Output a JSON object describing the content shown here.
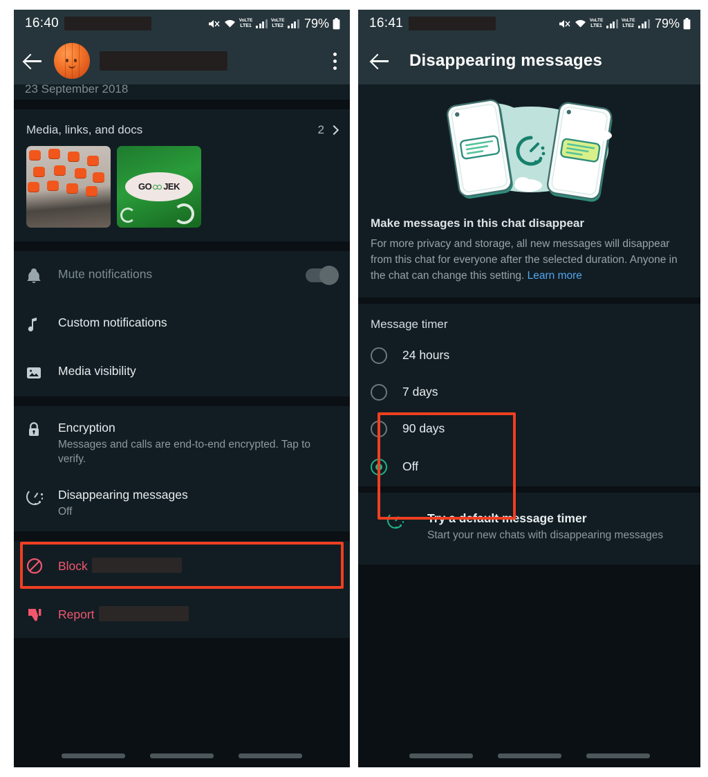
{
  "left_phone": {
    "status_bar": {
      "time": "16:40",
      "battery": "79%",
      "icons": [
        "mute-icon",
        "wifi-icon",
        "volte-lte1-icon",
        "signal-bars-icon",
        "volte-lte2-icon",
        "signal-bars-icon",
        "battery-icon"
      ],
      "volte_labels": [
        {
          "top": "VoLTE",
          "bottom": "LTE1"
        },
        {
          "top": "VoLTE",
          "bottom": "LTE2"
        }
      ]
    },
    "app_bar": {
      "back_icon": "back-arrow-icon",
      "avatar": "pumpkin-avatar",
      "contact_name": "",
      "overflow_icon": "kebab-menu-icon"
    },
    "scrolled_date": "23 September 2018",
    "media_section": {
      "label": "Media, links, and docs",
      "count": "2",
      "chevron": "chevron-right-icon",
      "thumbnails": [
        "orange-capped-bottles-photo",
        "gojek-green-bottle-photo"
      ],
      "thumb_b_text": [
        "GO",
        "JEK"
      ]
    },
    "settings_rows": [
      {
        "icon": "bell-icon",
        "title": "Mute notifications",
        "subtitle": "",
        "muted": true,
        "toggle": true,
        "toggle_on": false
      },
      {
        "icon": "music-note-icon",
        "title": "Custom notifications",
        "subtitle": "",
        "muted": false,
        "toggle": false
      },
      {
        "icon": "image-icon",
        "title": "Media visibility",
        "subtitle": "",
        "muted": false,
        "toggle": false
      }
    ],
    "privacy_rows": [
      {
        "icon": "lock-icon",
        "title": "Encryption",
        "subtitle": "Messages and calls are end-to-end encrypted. Tap to verify."
      },
      {
        "icon": "timer-icon",
        "title": "Disappearing messages",
        "subtitle": "Off",
        "highlighted": true
      }
    ],
    "danger_rows": [
      {
        "icon": "block-icon",
        "title": "Block",
        "redacted": true
      },
      {
        "icon": "thumbs-down-icon",
        "title": "Report",
        "redacted": true
      }
    ],
    "nav_bar": [
      "nav-pill-recents",
      "nav-pill-home",
      "nav-pill-back"
    ]
  },
  "right_phone": {
    "status_bar": {
      "time": "16:41",
      "battery": "79%",
      "volte_labels": [
        {
          "top": "VoLTE",
          "bottom": "LTE1"
        },
        {
          "top": "VoLTE",
          "bottom": "LTE2"
        }
      ]
    },
    "app_bar": {
      "back_icon": "back-arrow-icon",
      "title": "Disappearing messages"
    },
    "hero_illustration": "two-phones-with-timer-illustration",
    "blurb": {
      "heading": "Make messages in this chat disappear",
      "body": "For more privacy and storage, all new messages will disappear from this chat for everyone after the selected duration. Anyone in the chat can change this setting.",
      "link": "Learn more"
    },
    "message_timer": {
      "section_title": "Message timer",
      "options": [
        {
          "label": "24 hours",
          "selected": false
        },
        {
          "label": "7 days",
          "selected": false
        },
        {
          "label": "90 days",
          "selected": false
        },
        {
          "label": "Off",
          "selected": true
        }
      ],
      "highlighted_options": [
        "24 hours",
        "7 days",
        "90 days"
      ]
    },
    "default_timer_row": {
      "icon": "timer-icon",
      "title": "Try a default message timer",
      "subtitle": "Start your new chats with disappearing messages"
    },
    "nav_bar": [
      "nav-pill-recents",
      "nav-pill-home",
      "nav-pill-back"
    ]
  },
  "theme": {
    "page_bg": "#ffffff",
    "screen_bg": "#0a1014",
    "card_bg": "#121d23",
    "appbar_bg": "#26353c",
    "accent_green": "#20b486",
    "link_blue": "#53a6f0",
    "danger_red": "#f2566d",
    "highlight_red": "#ef3f22",
    "text_primary": "#e6edef",
    "text_secondary": "#8d999e"
  }
}
